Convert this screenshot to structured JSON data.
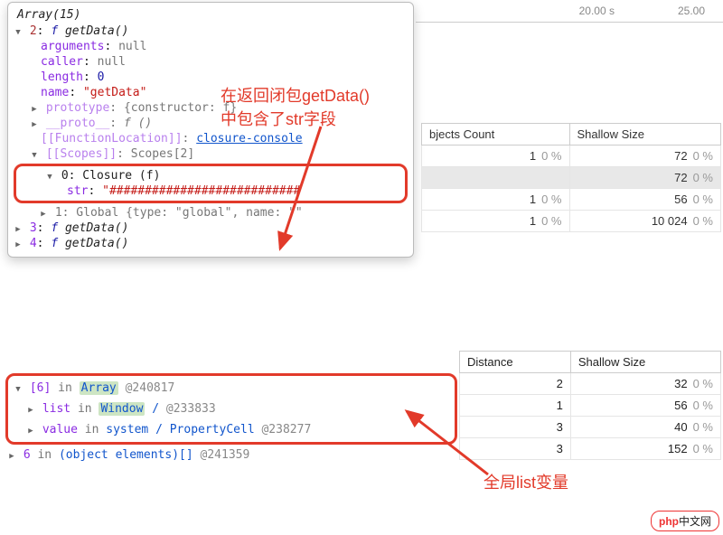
{
  "timeline": {
    "t1": "20.00 s",
    "t2": "25.00"
  },
  "popup": {
    "title": "Array(15)",
    "entry_index": "2",
    "fn_kw": "f",
    "fn_name": "getData()",
    "arguments_k": "arguments",
    "arguments_v": "null",
    "caller_k": "caller",
    "caller_v": "null",
    "length_k": "length",
    "length_v": "0",
    "name_k": "name",
    "name_v": "\"getData\"",
    "prototype_k": "prototype",
    "prototype_v": "{constructor: f}",
    "proto_k": "__proto__",
    "proto_v": "f ()",
    "fnloc_k": "[[FunctionLocation]]",
    "fnloc_v": "closure-console",
    "scopes_k": "[[Scopes]]",
    "scopes_v": "Scopes[2]",
    "scope0_label": "0: Closure (f)",
    "scope0_str_k": "str",
    "scope0_str_v": "\"###########################",
    "scope1_label": "1: Global {type: \"global\", name: \"\"",
    "entry3": "3",
    "entry3_v": "getData()",
    "entry4": "4",
    "entry4_v": "getData()"
  },
  "annotations": {
    "closure_note": "在返回闭包getData()\n中包含了str字段",
    "global_note": "全局list变量"
  },
  "table1": {
    "h1": "bjects Count",
    "h2": "Shallow Size",
    "rows": [
      {
        "c": "1",
        "cp": "0 %",
        "s": "72",
        "sp": "0 %",
        "sel": false
      },
      {
        "c": "",
        "cp": "",
        "s": "72",
        "sp": "0 %",
        "sel": true
      },
      {
        "c": "1",
        "cp": "0 %",
        "s": "56",
        "sp": "0 %",
        "sel": false
      },
      {
        "c": "1",
        "cp": "0 %",
        "s": "10 024",
        "sp": "0 %",
        "sel": false
      }
    ]
  },
  "table2": {
    "h1": "Distance",
    "h2": "Shallow Size",
    "rows": [
      {
        "d": "2",
        "s": "32",
        "sp": "0 %"
      },
      {
        "d": "1",
        "s": "56",
        "sp": "0 %"
      },
      {
        "d": "3",
        "s": "40",
        "sp": "0 %"
      },
      {
        "d": "3",
        "s": "152",
        "sp": "0 %"
      }
    ]
  },
  "retainers": {
    "r0_idx": "[6]",
    "r0_in": "in",
    "r0_obj": "Array",
    "r0_at": "@240817",
    "r1_key": "list",
    "r1_in": "in",
    "r1_obj": "Window",
    "r1_slash": "/",
    "r1_at": "@233833",
    "r2_key": "value",
    "r2_in": "in",
    "r2_obj": "system / PropertyCell",
    "r2_at": "@238277",
    "r3_key": "6",
    "r3_in": "in",
    "r3_obj": "(object elements)[]",
    "r3_at": "@241359"
  },
  "logo": {
    "brand": "php",
    "text": "中文网"
  }
}
